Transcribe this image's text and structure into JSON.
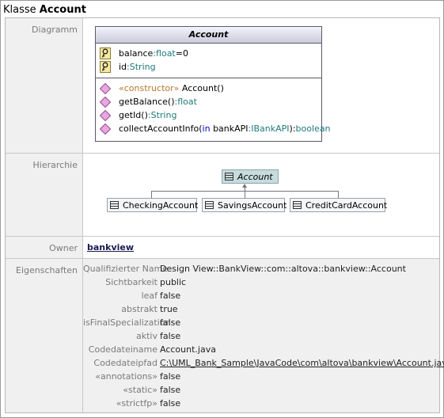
{
  "title": {
    "prefix": "Klasse",
    "name": "Account"
  },
  "diagram": {
    "label": "Diagramm",
    "class_name": "Account",
    "attributes": [
      {
        "name": "balance",
        "sep": ":",
        "type": "float",
        "default": "=0"
      },
      {
        "name": "id",
        "sep": ":",
        "type": "String"
      }
    ],
    "operations": [
      {
        "stereotype": "«constructor»",
        "text": " Account()"
      },
      {
        "text": "getBalance()",
        "sep": ":",
        "type": "float"
      },
      {
        "text": "getId()",
        "sep": ":",
        "type": "String"
      },
      {
        "text": "collectAccountInfo(",
        "kw": "in",
        "param": " bankAPI",
        "sep": ":",
        "ptype": "IBankAPI",
        "close": "):",
        "type": "boolean"
      }
    ]
  },
  "hierarchy": {
    "label": "Hierarchie",
    "root": "Account",
    "children": [
      "CheckingAccount",
      "SavingsAccount",
      "CreditCardAccount"
    ]
  },
  "owner": {
    "label": "Owner",
    "value": "bankview"
  },
  "properties": {
    "label": "Eigenschaften",
    "items": [
      {
        "key": "Qualifizierter Name",
        "value": "Design View::BankView::com::altova::bankview::Account"
      },
      {
        "key": "Sichtbarkeit",
        "value": "public"
      },
      {
        "key": "leaf",
        "value": "false"
      },
      {
        "key": "abstrakt",
        "value": "true"
      },
      {
        "key": "isFinalSpecialization",
        "value": "false"
      },
      {
        "key": "aktiv",
        "value": "false"
      },
      {
        "key": "Codedateiname",
        "value": "Account.java"
      },
      {
        "key": "Codedateipfad",
        "value": "C:\\UML_Bank_Sample\\JavaCode\\com\\altova\\bankview\\Account.java"
      },
      {
        "key": "«annotations»",
        "value": "false"
      },
      {
        "key": "«static»",
        "value": "false"
      },
      {
        "key": "«strictfp»",
        "value": "false"
      }
    ]
  },
  "colors": {
    "teal": "#1e7a7a",
    "stereotype": "#b8762c",
    "keyword": "#0000c8",
    "operation_icon": "#d278c8",
    "root_node": "#c7dcde"
  },
  "icons": {
    "attribute": "key-icon",
    "operation": "operation-diamond-icon",
    "class_node": "class-icon"
  }
}
